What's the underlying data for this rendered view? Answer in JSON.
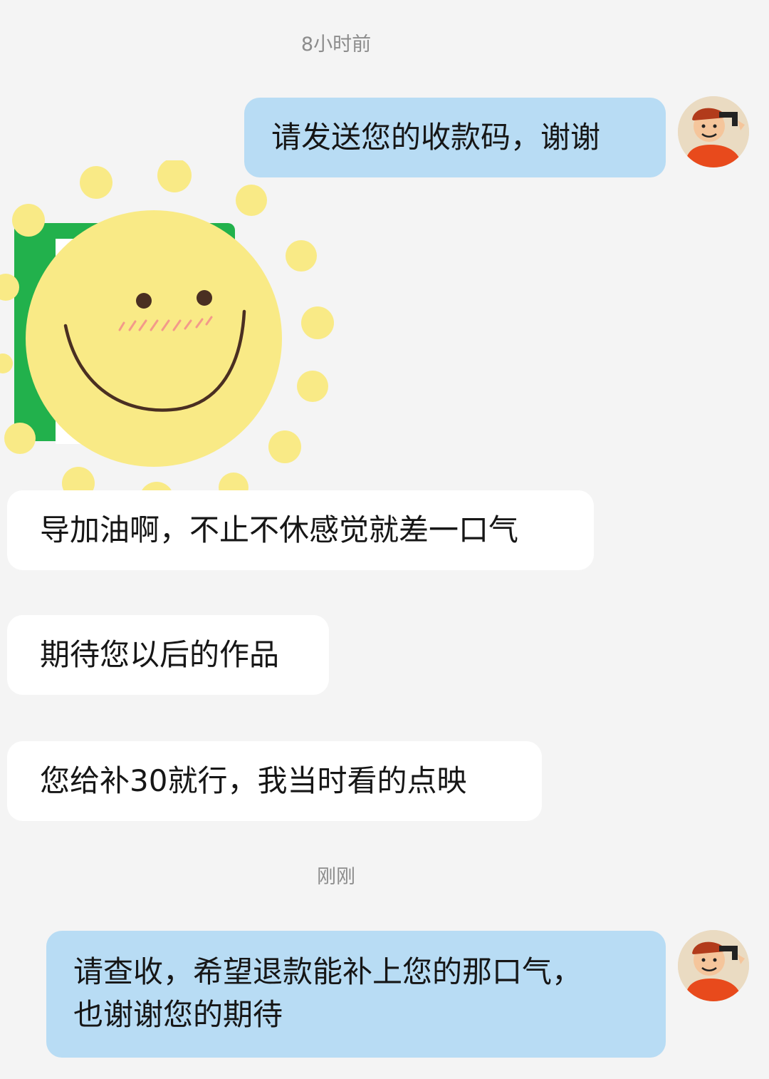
{
  "timestamps": {
    "first": "8小时前",
    "second": "刚刚"
  },
  "messages": [
    {
      "sender": "self",
      "text": "请发送您的收款码，谢谢"
    },
    {
      "sender": "other",
      "type": "image",
      "image": "smiley-sun-sticker-over-payment-code"
    },
    {
      "sender": "other",
      "text": "导加油啊，不止不休感觉就差一口气"
    },
    {
      "sender": "other",
      "text": "期待您以后的作品"
    },
    {
      "sender": "other",
      "text": "您给补30就行，我当时看的点映"
    },
    {
      "sender": "self",
      "text": "请查收，希望退款能补上您的那口气，\n也谢谢您的期待"
    }
  ],
  "colors": {
    "background": "#f4f4f4",
    "self_bubble": "#b8dcf4",
    "other_bubble": "#ffffff",
    "timestamp_text": "#8c8c8c",
    "sticker_yellow": "#f9ea86",
    "payment_green": "#22b14c"
  }
}
